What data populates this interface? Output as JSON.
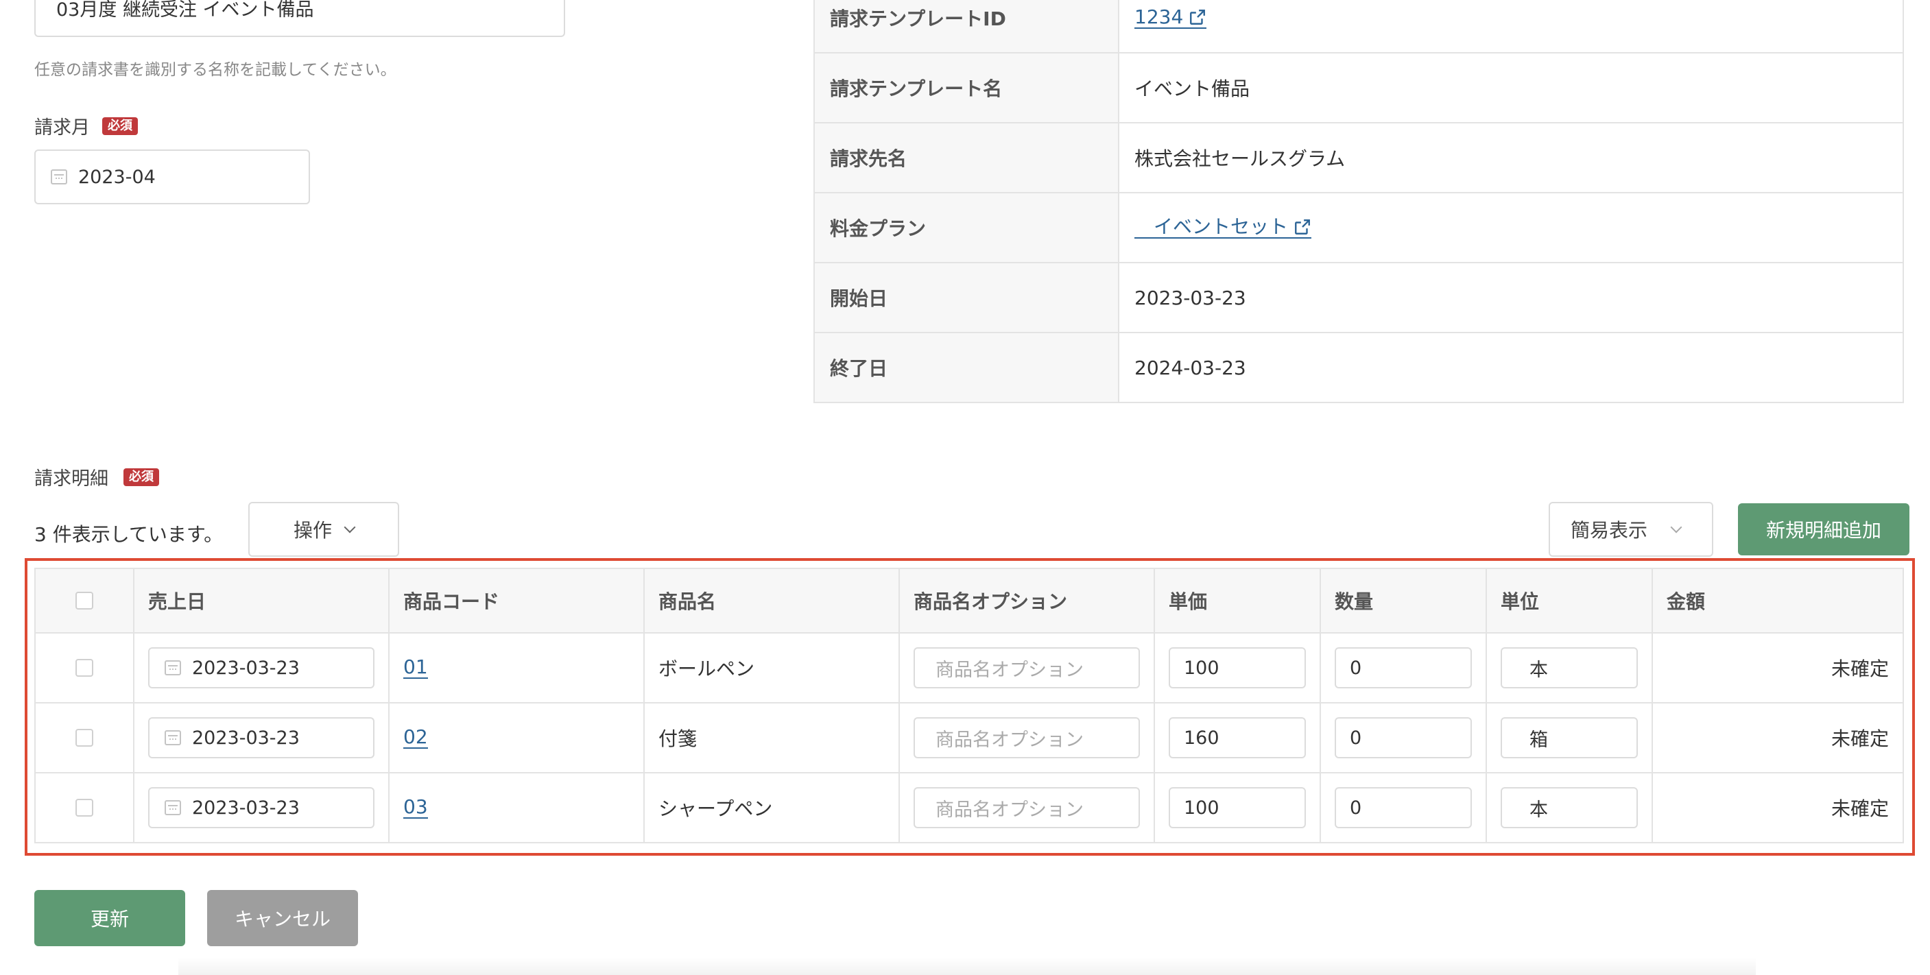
{
  "form": {
    "invoice_name_value": "03月度 継続受注 イベント備品",
    "invoice_name_hint": "任意の請求書を識別する名称を記載してください。",
    "billing_month_label": "請求月",
    "required_badge": "必須",
    "billing_month_value": "2023-04"
  },
  "info": {
    "rows": [
      {
        "key": "請求テンプレートID",
        "value": "1234"
      },
      {
        "key": "請求テンプレート名",
        "value": "イベント備品"
      },
      {
        "key": "請求先名",
        "value": "株式会社セールスグラム"
      },
      {
        "key": "料金プラン",
        "value": "イベントセット"
      },
      {
        "key": "開始日",
        "value": "2023-03-23"
      },
      {
        "key": "終了日",
        "value": "2024-03-23"
      }
    ]
  },
  "details": {
    "section_label": "請求明細",
    "required_badge": "必須",
    "count_text": "3 件表示しています。",
    "actions_button": "操作",
    "view_mode_select": "簡易表示",
    "add_button": "新規明細追加",
    "columns": [
      "売上日",
      "商品コード",
      "商品名",
      "商品名オプション",
      "単価",
      "数量",
      "単位",
      "金額"
    ],
    "option_placeholder": "商品名オプション",
    "rows": [
      {
        "date": "2023-03-23",
        "code": "01",
        "name": "ボールペン",
        "price": "100",
        "qty": "0",
        "unit": "本",
        "amount": "未確定"
      },
      {
        "date": "2023-03-23",
        "code": "02",
        "name": "付箋",
        "price": "160",
        "qty": "0",
        "unit": "箱",
        "amount": "未確定"
      },
      {
        "date": "2023-03-23",
        "code": "03",
        "name": "シャープペン",
        "price": "100",
        "qty": "0",
        "unit": "本",
        "amount": "未確定"
      }
    ]
  },
  "footer": {
    "update_button": "更新",
    "cancel_button": "キャンセル"
  },
  "colors": {
    "accent_green": "#5e9a73",
    "link_blue": "#2c6496",
    "required_red": "#c0393b",
    "highlight_red": "#de4a33"
  }
}
